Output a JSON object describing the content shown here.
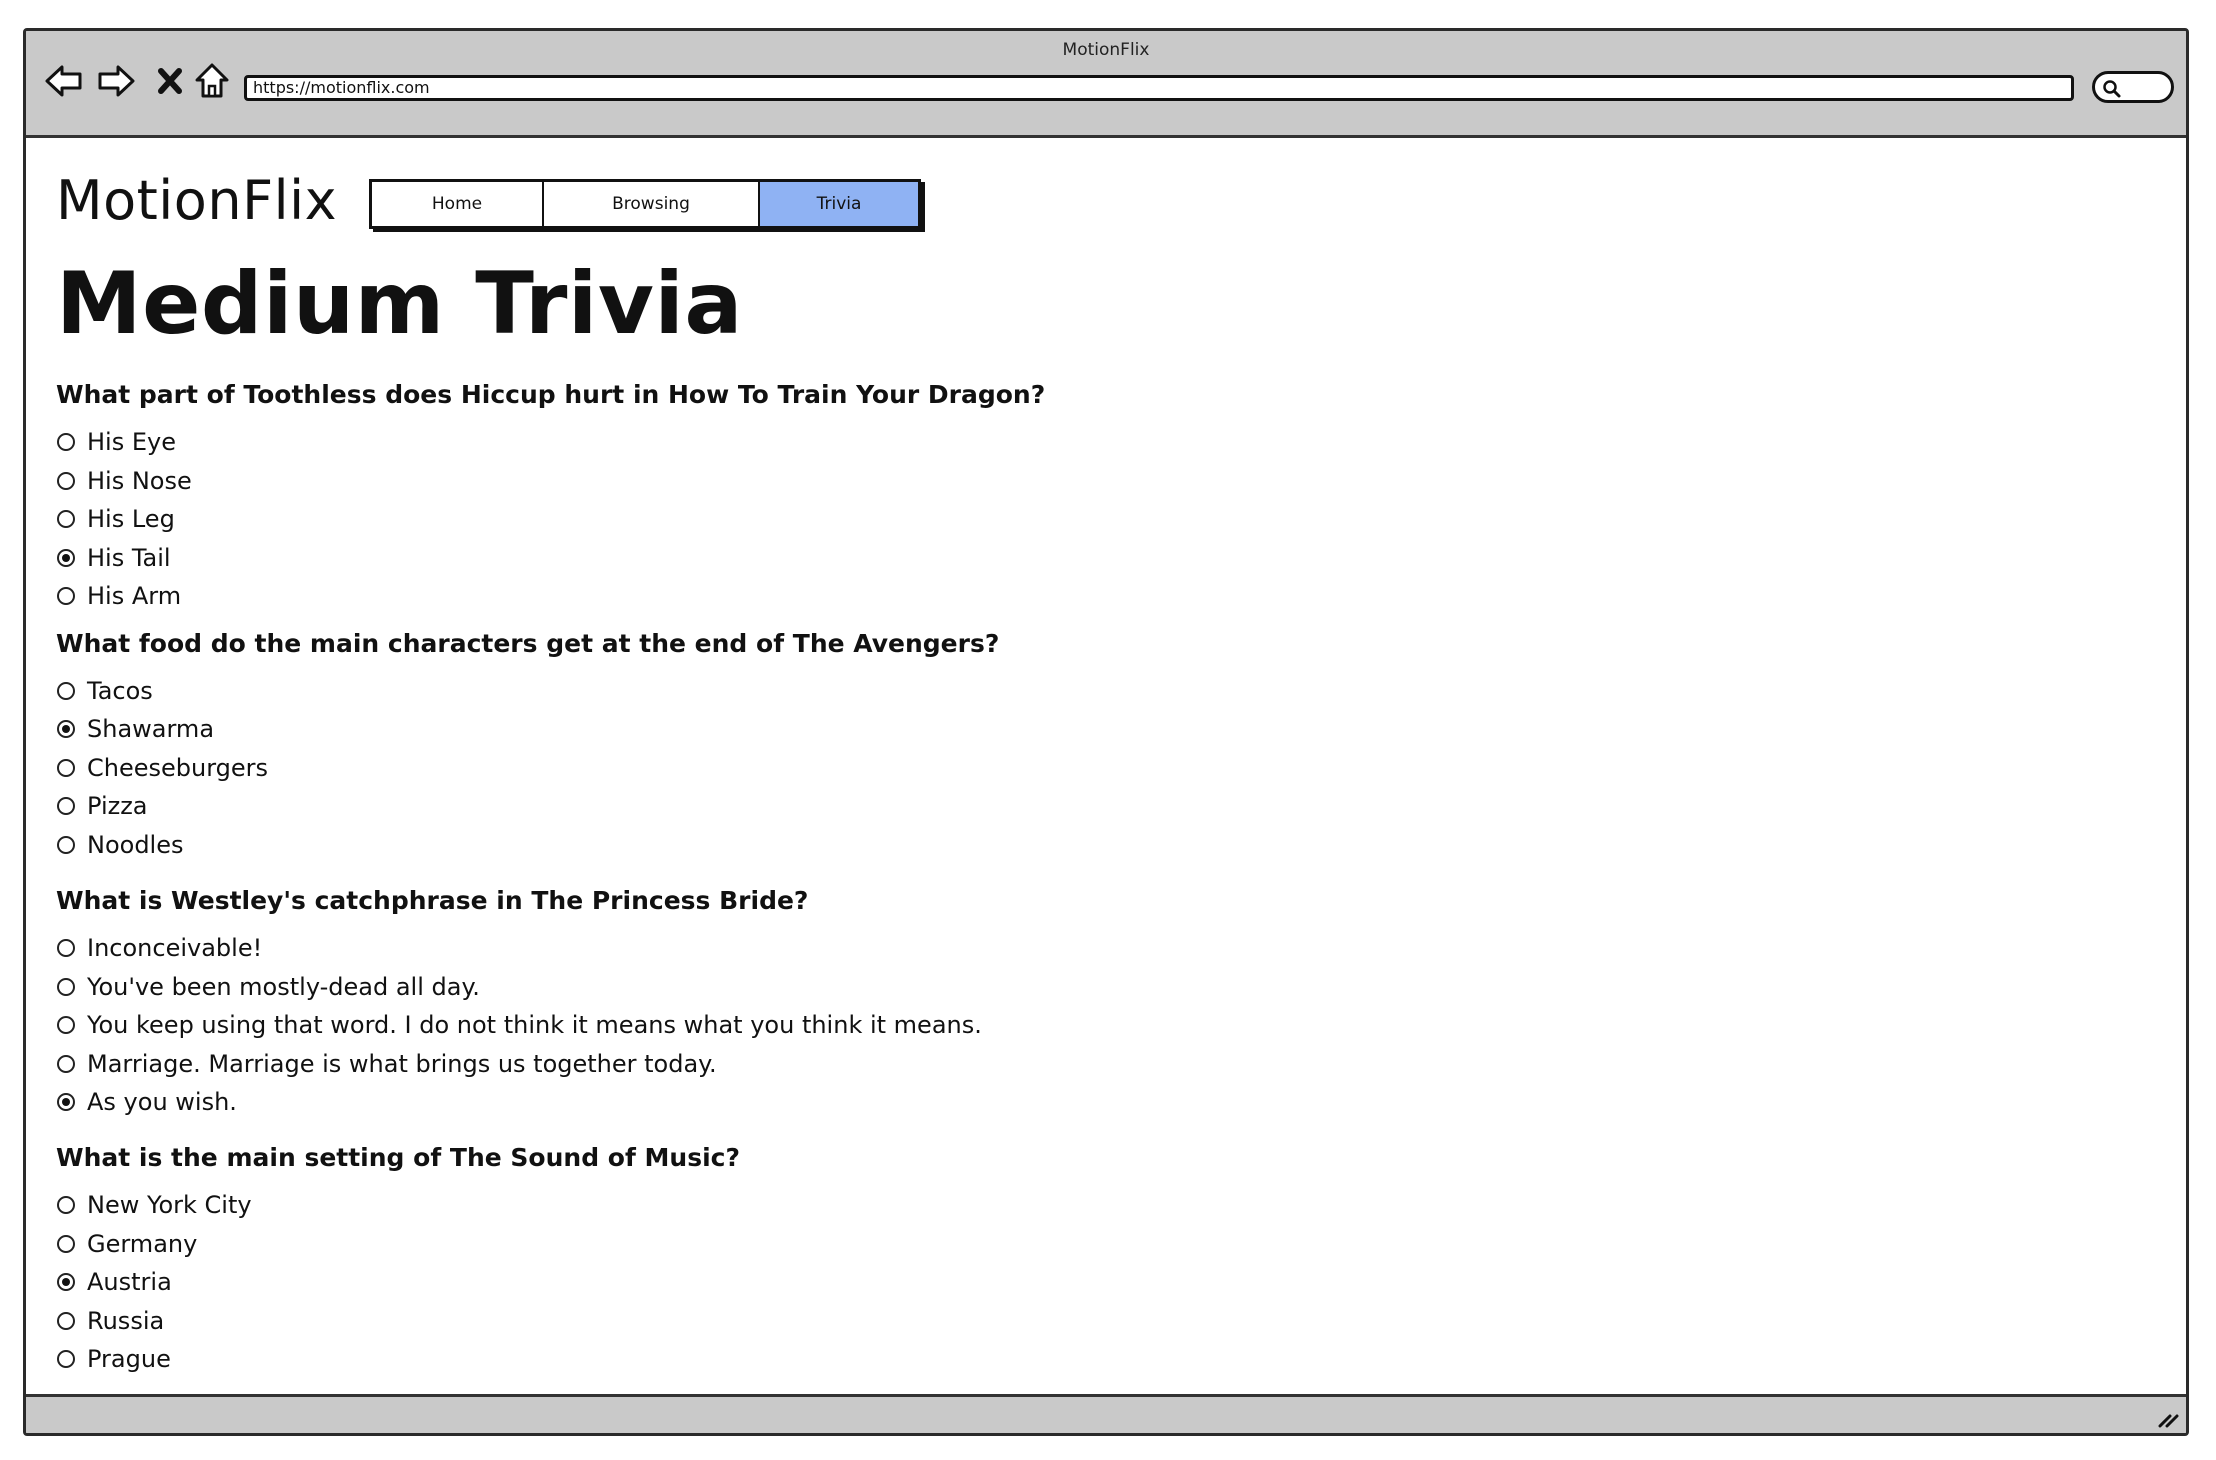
{
  "window": {
    "title": "MotionFlix"
  },
  "browser": {
    "back_icon": "arrow-left-icon",
    "forward_icon": "arrow-right-icon",
    "stop_icon": "close-x-icon",
    "home_icon": "home-icon",
    "url": "https://motionflix.com",
    "search_icon": "search-icon"
  },
  "site": {
    "brand": "MotionFlix"
  },
  "nav": {
    "tabs": [
      {
        "label": "Home",
        "active": false
      },
      {
        "label": "Browsing",
        "active": false
      },
      {
        "label": "Trivia",
        "active": true
      }
    ],
    "active_color": "#8fb2f3"
  },
  "page": {
    "title": "Medium Trivia"
  },
  "questions": [
    {
      "text": "What part of Toothless does Hiccup hurt in How To Train Your Dragon?",
      "options": [
        "His Eye",
        "His Nose",
        "His Leg",
        "His Tail",
        "His Arm"
      ],
      "selected": 3
    },
    {
      "text": "What food do the main characters get at the end of The Avengers?",
      "options": [
        "Tacos",
        "Shawarma",
        "Cheeseburgers",
        "Pizza",
        "Noodles"
      ],
      "selected": 1
    },
    {
      "text": "What is Westley's catchphrase in The Princess Bride?",
      "options": [
        "Inconceivable!",
        "You've been mostly-dead all day.",
        "You keep using that word. I do not think it means what you think it means.",
        "Marriage. Marriage is what brings us together today.",
        "As you wish."
      ],
      "selected": 4
    },
    {
      "text": "What is the main setting of The Sound of Music?",
      "options": [
        "New York City",
        "Germany",
        "Austria",
        "Russia",
        "Prague"
      ],
      "selected": 2
    }
  ]
}
